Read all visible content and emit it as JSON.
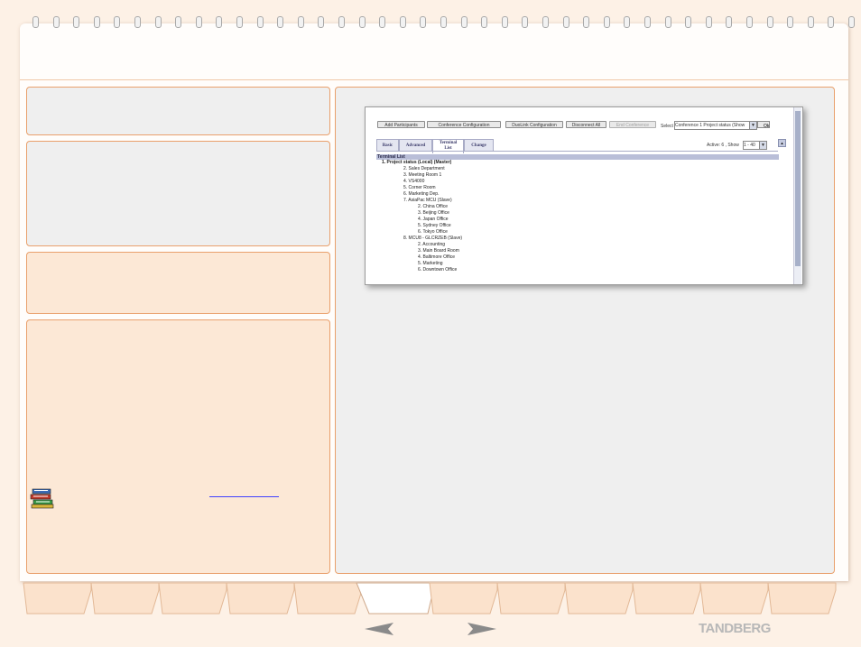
{
  "brand": {
    "logo_text": "TANDBERG"
  },
  "left_panel": {
    "link_text": ""
  },
  "screenshot": {
    "toolbar": {
      "add_participants": "Add Participants",
      "conference_configuration": "Conference Configuration",
      "duolink_configuration": "DuoLink Configuration",
      "disconnect_all": "Disconnect All",
      "end_conference": "End Conference",
      "select_label": "Select",
      "select_value": "Conference 1 Project status (Show",
      "ok": "Ok"
    },
    "tabs": [
      {
        "label": "Basic"
      },
      {
        "label": "Advanced"
      },
      {
        "label": "Terminal\nList"
      },
      {
        "label": "Change"
      }
    ],
    "active_label": "Active: 6 , Show",
    "show_value": "1 - 40",
    "list_header": "Terminal List",
    "tree": [
      {
        "text": "1.    Project status (Local) (Master)",
        "level": 0,
        "bold": true
      },
      {
        "text": "2. Sales Department",
        "level": 1
      },
      {
        "text": "3. Meeting Room 1",
        "level": 1
      },
      {
        "text": "4. VS4000",
        "level": 1
      },
      {
        "text": "5. Corner Room",
        "level": 1
      },
      {
        "text": "6. Marketing Dep.",
        "level": 1
      },
      {
        "text": "7. AsiaPac MCU (Slave)",
        "level": 1
      },
      {
        "text": "2. China Office",
        "level": 2
      },
      {
        "text": "3. Beijing Office",
        "level": 2
      },
      {
        "text": "4. Japan Office",
        "level": 2
      },
      {
        "text": "5. Sydney Office",
        "level": 2
      },
      {
        "text": "6. Tokyo Office",
        "level": 2
      },
      {
        "text": "8. MCU8 - GLCRZEB (Slave)",
        "level": 1
      },
      {
        "text": "2. Accounting",
        "level": 2
      },
      {
        "text": "3. Main Board Room",
        "level": 2
      },
      {
        "text": "4. Baltimore Office",
        "level": 2
      },
      {
        "text": "5. Marketing",
        "level": 2
      },
      {
        "text": "6. Downtown Office",
        "level": 2
      }
    ]
  },
  "nav": {
    "tab_count": 12,
    "active_index": 5
  },
  "colors": {
    "background": "#fdf1e6",
    "panel_border": "#e9a06c",
    "panel_gray": "#efefef",
    "panel_orange": "#fce8d6",
    "tab_fill": "#fbe2cc",
    "arrow": "#8a8a8a",
    "logo": "#b8b8b8"
  }
}
